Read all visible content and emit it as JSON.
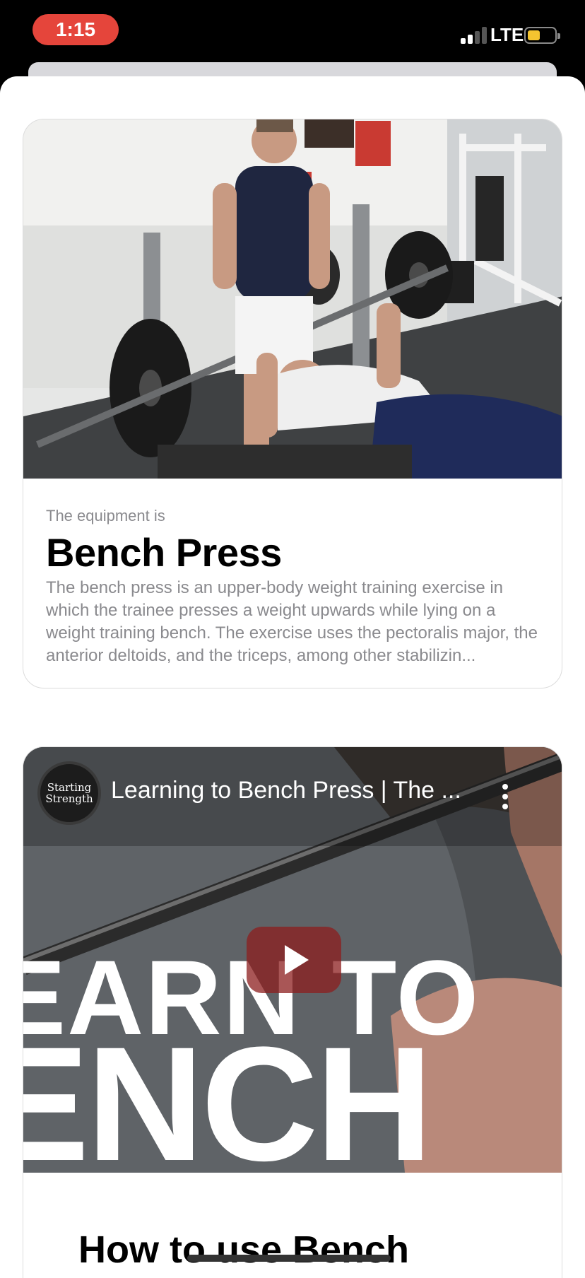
{
  "status_bar": {
    "time": "1:15",
    "network": "LTE",
    "battery_level": 0.45,
    "signal_bars": 2,
    "signal_bars_total": 4
  },
  "equipment_card": {
    "eyebrow": "The equipment is",
    "title": "Bench Press",
    "description": "The bench press is an upper-body weight training exercise in which the trainee presses a weight upwards while lying on a weight training bench. The exercise uses the pectoralis major, the anterior deltoids, and the triceps, among other stabilizin..."
  },
  "video_card": {
    "channel_logo_text": "Starting Strength",
    "video_title": "Learning to Bench Press | The ...",
    "overlay_line_1": "EARN TO",
    "overlay_line_2": "ENCH",
    "below_title": "How to use Bench"
  },
  "colors": {
    "time_pill": "#e5453b",
    "battery_fill": "#f4c430",
    "play_button": "#8c1e1e"
  }
}
